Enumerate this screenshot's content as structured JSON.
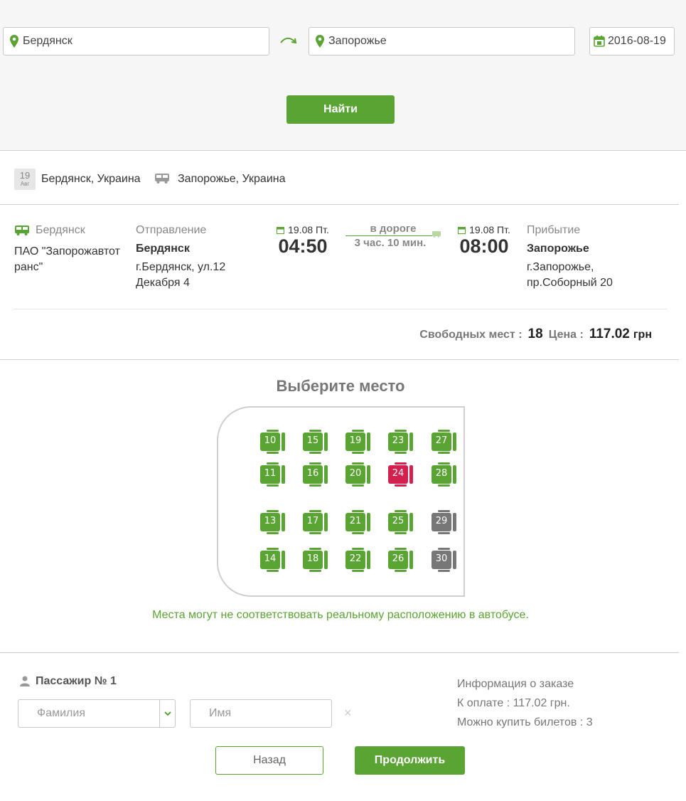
{
  "search": {
    "from": "Бердянск",
    "to": "Запорожье",
    "date": "2016-08-19",
    "find_label": "Найти"
  },
  "route": {
    "cal_day": "19",
    "cal_month": "Авг",
    "from": "Бердянск, Украина",
    "to": "Запорожье, Украина"
  },
  "trip": {
    "carrier_city": "Бердянск",
    "carrier_name": "ПАО \"Запорожавтотранс\"",
    "departure_label": "Отправление",
    "departure_city": "Бердянск",
    "departure_address": "г.Бердянск, ул.12 Декабря 4",
    "departure_date": "19.08 Пт.",
    "departure_time": "04:50",
    "road_label": "в дороге",
    "duration": "3 час. 10 мин.",
    "arrival_date": "19.08 Пт.",
    "arrival_time": "08:00",
    "arrival_label": "Прибытие",
    "arrival_city": "Запорожье",
    "arrival_address": "г.Запорожье, пр.Соборный 20"
  },
  "summary": {
    "free_label": "Свободных мест :",
    "free_count": "18",
    "price_label": "Цена :",
    "price": "117.02",
    "currency": "грн"
  },
  "seatmap": {
    "title": "Выберите место",
    "note": "Места могут не соответствовать реальному расположению в автобусе.",
    "colors": {
      "free": "#5aa434",
      "selected": "#d4204f",
      "taken": "#777777"
    },
    "seats": [
      {
        "num": "10",
        "status": "free"
      },
      {
        "num": "15",
        "status": "free"
      },
      {
        "num": "19",
        "status": "free"
      },
      {
        "num": "23",
        "status": "free"
      },
      {
        "num": "27",
        "status": "free"
      },
      {
        "num": "11",
        "status": "free"
      },
      {
        "num": "16",
        "status": "free"
      },
      {
        "num": "20",
        "status": "free"
      },
      {
        "num": "24",
        "status": "selected"
      },
      {
        "num": "28",
        "status": "free"
      },
      {
        "num": "13",
        "status": "free"
      },
      {
        "num": "17",
        "status": "free"
      },
      {
        "num": "21",
        "status": "free"
      },
      {
        "num": "25",
        "status": "free"
      },
      {
        "num": "29",
        "status": "taken"
      },
      {
        "num": "14",
        "status": "free"
      },
      {
        "num": "18",
        "status": "free"
      },
      {
        "num": "22",
        "status": "free"
      },
      {
        "num": "26",
        "status": "free"
      },
      {
        "num": "30",
        "status": "taken"
      }
    ]
  },
  "passenger": {
    "title": "Пассажир № 1",
    "surname_placeholder": "Фамилия",
    "name_placeholder": "Имя",
    "remove": "×"
  },
  "order": {
    "title": "Информация о заказе",
    "to_pay": "К оплате : 117.02 грн.",
    "can_buy": "Можно купить билетов : 3"
  },
  "actions": {
    "back": "Назад",
    "continue": "Продолжить"
  }
}
